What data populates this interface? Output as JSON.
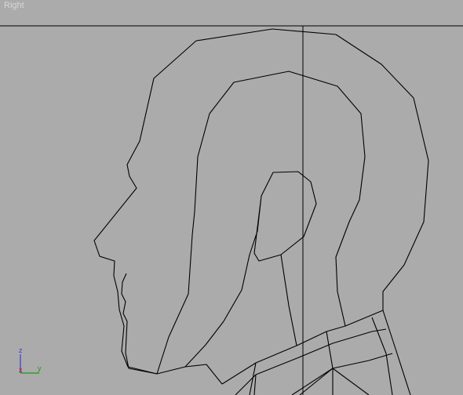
{
  "viewport": {
    "label": "Right",
    "background": "#ababab",
    "wire_color": "#000000"
  },
  "axis_gizmo": {
    "z_label": "z",
    "x_label": "x",
    "y_label": "y",
    "z_color": "#3a3ad0",
    "x_color": "#d01a1a",
    "y_color": "#1a9a1a"
  }
}
